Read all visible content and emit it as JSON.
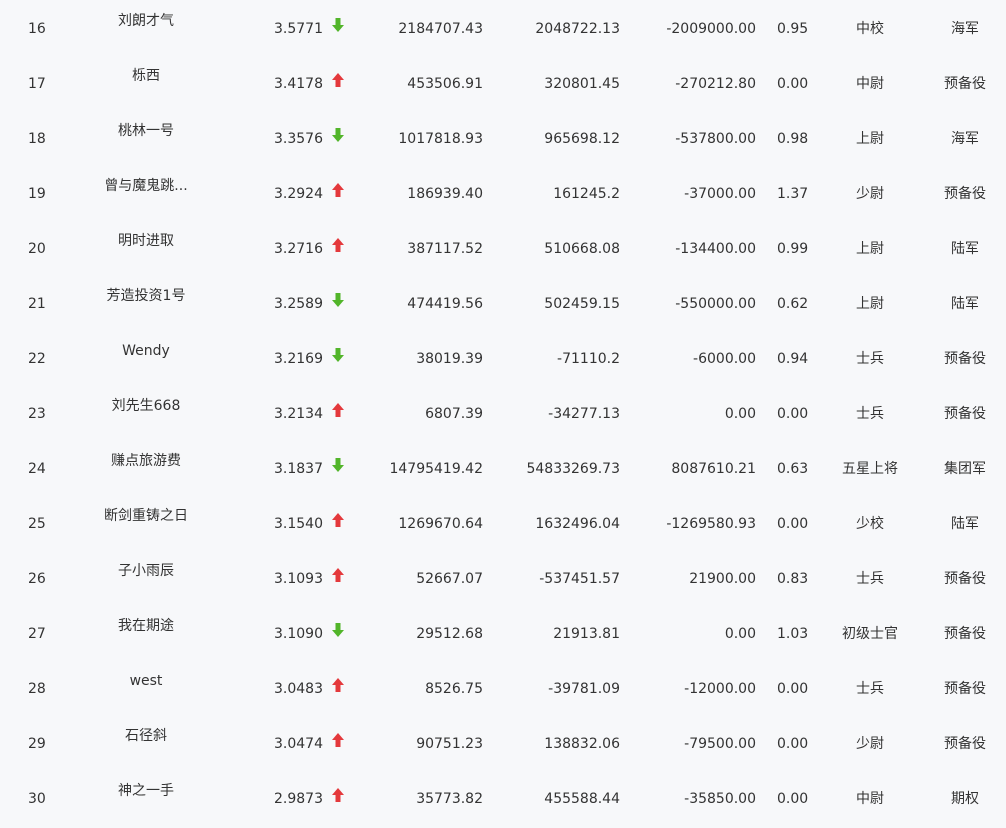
{
  "colors": {
    "up": "#e4393c",
    "down": "#52b52a",
    "text": "#333333",
    "background": "#f7f8fa"
  },
  "rows": [
    {
      "rank": "16",
      "name": "刘朗才气",
      "score": "3.5771",
      "trend": "down",
      "v1": "2184707.43",
      "v2": "2048722.13",
      "v3": "-2009000.00",
      "v4": "0.95",
      "military_rank": "中校",
      "branch": "海军"
    },
    {
      "rank": "17",
      "name": "栎西",
      "score": "3.4178",
      "trend": "up",
      "v1": "453506.91",
      "v2": "320801.45",
      "v3": "-270212.80",
      "v4": "0.00",
      "military_rank": "中尉",
      "branch": "预备役"
    },
    {
      "rank": "18",
      "name": "桃林一号",
      "score": "3.3576",
      "trend": "down",
      "v1": "1017818.93",
      "v2": "965698.12",
      "v3": "-537800.00",
      "v4": "0.98",
      "military_rank": "上尉",
      "branch": "海军"
    },
    {
      "rank": "19",
      "name": "曾与魔鬼跳...",
      "score": "3.2924",
      "trend": "up",
      "v1": "186939.40",
      "v2": "161245.2",
      "v3": "-37000.00",
      "v4": "1.37",
      "military_rank": "少尉",
      "branch": "预备役"
    },
    {
      "rank": "20",
      "name": "明时进取",
      "score": "3.2716",
      "trend": "up",
      "v1": "387117.52",
      "v2": "510668.08",
      "v3": "-134400.00",
      "v4": "0.99",
      "military_rank": "上尉",
      "branch": "陆军"
    },
    {
      "rank": "21",
      "name": "芳造投资1号",
      "score": "3.2589",
      "trend": "down",
      "v1": "474419.56",
      "v2": "502459.15",
      "v3": "-550000.00",
      "v4": "0.62",
      "military_rank": "上尉",
      "branch": "陆军"
    },
    {
      "rank": "22",
      "name": "Wendy",
      "score": "3.2169",
      "trend": "down",
      "v1": "38019.39",
      "v2": "-71110.2",
      "v3": "-6000.00",
      "v4": "0.94",
      "military_rank": "士兵",
      "branch": "预备役"
    },
    {
      "rank": "23",
      "name": "刘先生668",
      "score": "3.2134",
      "trend": "up",
      "v1": "6807.39",
      "v2": "-34277.13",
      "v3": "0.00",
      "v4": "0.00",
      "military_rank": "士兵",
      "branch": "预备役"
    },
    {
      "rank": "24",
      "name": "赚点旅游费",
      "score": "3.1837",
      "trend": "down",
      "v1": "14795419.42",
      "v2": "54833269.73",
      "v3": "8087610.21",
      "v4": "0.63",
      "military_rank": "五星上将",
      "branch": "集团军"
    },
    {
      "rank": "25",
      "name": "断剑重铸之日",
      "score": "3.1540",
      "trend": "up",
      "v1": "1269670.64",
      "v2": "1632496.04",
      "v3": "-1269580.93",
      "v4": "0.00",
      "military_rank": "少校",
      "branch": "陆军"
    },
    {
      "rank": "26",
      "name": "子小雨辰",
      "score": "3.1093",
      "trend": "up",
      "v1": "52667.07",
      "v2": "-537451.57",
      "v3": "21900.00",
      "v4": "0.83",
      "military_rank": "士兵",
      "branch": "预备役"
    },
    {
      "rank": "27",
      "name": "我在期途",
      "score": "3.1090",
      "trend": "down",
      "v1": "29512.68",
      "v2": "21913.81",
      "v3": "0.00",
      "v4": "1.03",
      "military_rank": "初级士官",
      "branch": "预备役"
    },
    {
      "rank": "28",
      "name": "west",
      "score": "3.0483",
      "trend": "up",
      "v1": "8526.75",
      "v2": "-39781.09",
      "v3": "-12000.00",
      "v4": "0.00",
      "military_rank": "士兵",
      "branch": "预备役"
    },
    {
      "rank": "29",
      "name": "石径斜",
      "score": "3.0474",
      "trend": "up",
      "v1": "90751.23",
      "v2": "138832.06",
      "v3": "-79500.00",
      "v4": "0.00",
      "military_rank": "少尉",
      "branch": "预备役"
    },
    {
      "rank": "30",
      "name": "神之一手",
      "score": "2.9873",
      "trend": "up",
      "v1": "35773.82",
      "v2": "455588.44",
      "v3": "-35850.00",
      "v4": "0.00",
      "military_rank": "中尉",
      "branch": "期权"
    }
  ]
}
